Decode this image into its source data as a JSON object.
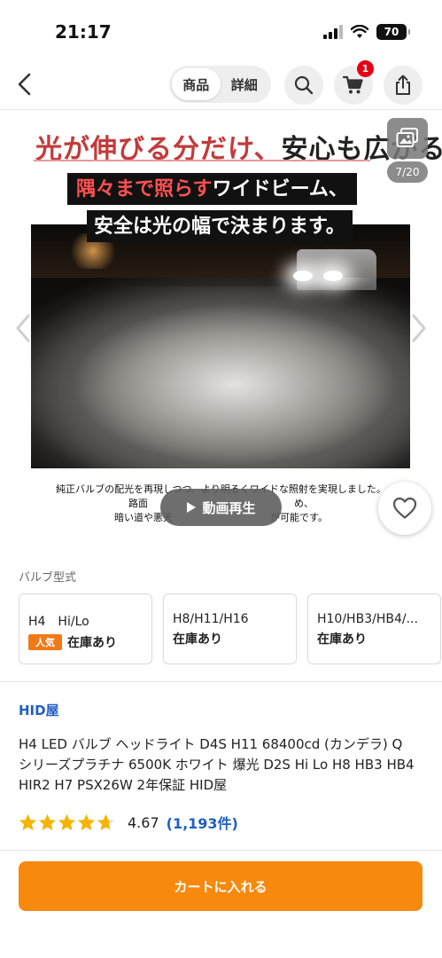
{
  "status_bar": {
    "time": "21:17",
    "battery": "70"
  },
  "nav": {
    "tabs": [
      {
        "label": "商品",
        "active": true
      },
      {
        "label": "詳細",
        "active": false
      }
    ],
    "cart_count": "1"
  },
  "gallery": {
    "headline_part1": "光が伸びる分だけ、",
    "headline_part2": "安心も広がる",
    "banner1_red": "隅々まで照らす",
    "banner1_white": "ワイドビーム、",
    "banner2": "安全は光の幅で決まります。",
    "caption_line1": "純正バルブの配光を再現しつつ、より明るくワイドな照射を実現しました。",
    "caption_line2": "路面　　　　　　　　　　　　　　　め、",
    "caption_line3": "暗い道や悪天　　　　　　　　　　が可能です。",
    "video_label": "動画再生",
    "counter": "7/20"
  },
  "variants": {
    "label": "バルブ型式",
    "items": [
      {
        "name": "H4　Hi/Lo",
        "tag": "人気",
        "stock": "在庫あり"
      },
      {
        "name": "H8/H11/H16",
        "tag": "",
        "stock": "在庫あり"
      },
      {
        "name": "H10/HB3/HB4/...",
        "tag": "",
        "stock": "在庫あり"
      }
    ]
  },
  "product": {
    "shop": "HID屋",
    "title": "H4 LED バルブ ヘッドライト D4S H11 68400cd (カンデラ) Q シリーズプラチナ 6500K ホワイト 爆光 D2S Hi Lo H8 HB3 HB4 HIR2 H7 PSX26W 2年保証 HID屋",
    "rating": 4.67,
    "rating_text": "4.67",
    "reviews": "(1,193件)"
  },
  "cta": {
    "add_to_cart": "カートに入れる"
  },
  "colors": {
    "accent": "#f7890e",
    "link": "#1f5fc2",
    "badge": "#e60012",
    "popular": "#f07a16"
  }
}
